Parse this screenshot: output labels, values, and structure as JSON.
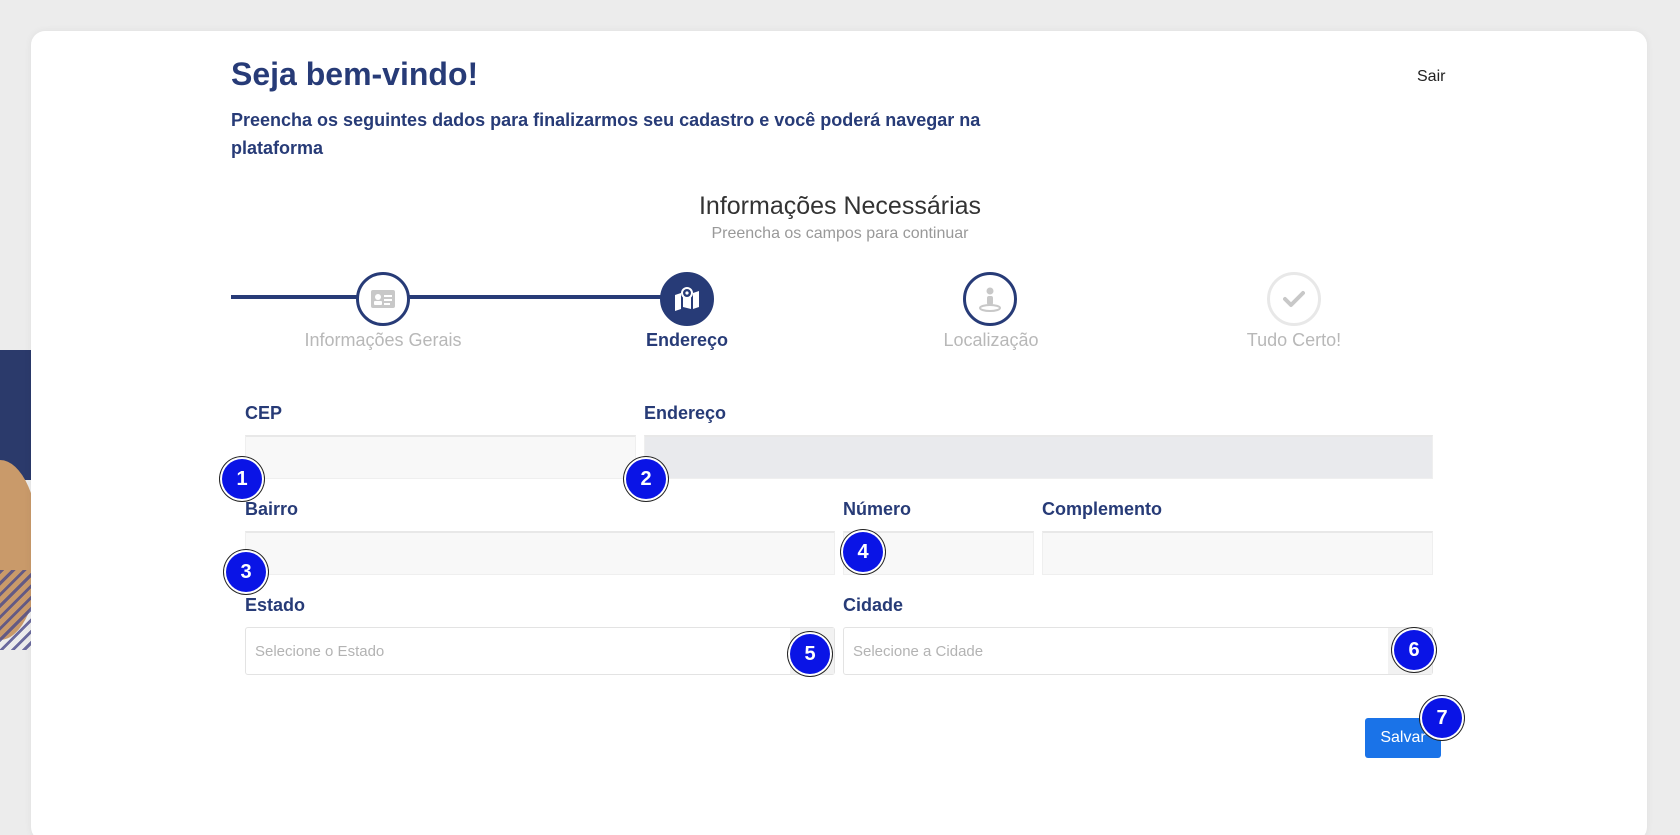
{
  "header": {
    "title": "Seja bem-vindo!",
    "subtitle": "Preencha os seguintes dados para finalizarmos seu cadastro e você poderá navegar na plataforma",
    "logout_label": "Sair"
  },
  "section": {
    "title": "Informações Necessárias",
    "subtitle": "Preencha os campos para continuar"
  },
  "steps": [
    {
      "label": "Informações Gerais",
      "icon": "id-card-icon",
      "state": "completed"
    },
    {
      "label": "Endereço",
      "icon": "map-marker-icon",
      "state": "active"
    },
    {
      "label": "Localização",
      "icon": "person-location-icon",
      "state": "pending"
    },
    {
      "label": "Tudo Certo!",
      "icon": "check-icon",
      "state": "pending"
    }
  ],
  "form": {
    "cep": {
      "label": "CEP",
      "value": ""
    },
    "endereco": {
      "label": "Endereço",
      "value": ""
    },
    "bairro": {
      "label": "Bairro",
      "value": ""
    },
    "numero": {
      "label": "Número",
      "value": ""
    },
    "complemento": {
      "label": "Complemento",
      "value": ""
    },
    "estado": {
      "label": "Estado",
      "placeholder": "Selecione o Estado"
    },
    "cidade": {
      "label": "Cidade",
      "placeholder": "Selecione a Cidade"
    },
    "save_label": "Salvar"
  },
  "markers": [
    "1",
    "2",
    "3",
    "4",
    "5",
    "6",
    "7"
  ],
  "colors": {
    "primary": "#273b77",
    "button": "#1a73e8",
    "marker": "#0a14e6"
  }
}
